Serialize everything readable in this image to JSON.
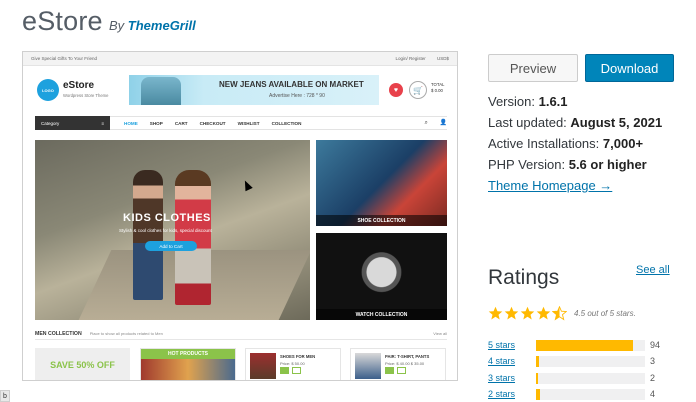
{
  "header": {
    "title": "eStore",
    "by_prefix": "By",
    "author": "ThemeGrill"
  },
  "screenshot": {
    "topbar_left": "Give Special Gifts To Your Friend",
    "topbar_links": [
      "Login/ Register",
      "USD$"
    ],
    "logo_text": "LOGO",
    "brand_name": "eStore",
    "brand_tagline": "Wordpress Store Theme",
    "ad_headline": "NEW JEANS AVAILABLE ON MARKET",
    "ad_sub": "Advertise Here : 728 * 90",
    "heart_icon": "♥",
    "cart_icon": "🛒",
    "total_label": "TOTAL",
    "total_value": "$ 0.00",
    "category_label": "Category",
    "category_icon": "≡",
    "nav": [
      "HOME",
      "SHOP",
      "CART",
      "CHECKOUT",
      "WISHLIST",
      "COLLECTION"
    ],
    "nav_icons": [
      "⌕",
      "👤"
    ],
    "hero_title": "KIDS CLOTHES",
    "hero_sub": "Stylish & cool clothes for kids, special discount",
    "hero_button": "Add to Cart",
    "shoe_caption": "SHOE COLLECTION",
    "watch_caption": "WATCH COLLECTION",
    "men_title": "MEN COLLECTION",
    "men_sub": "Place to show all products related to Men",
    "view_all": "View all",
    "save_text": "SAVE 50% OFF",
    "hot_products": "HOT PRODUCTS",
    "products": [
      {
        "name": "SHOES FOR MEN",
        "price": "Price: $ 50.00"
      },
      {
        "name": "PAIR: T-SHIRT, PANTS",
        "price": "Price: $ 40.00  $ 35.00"
      }
    ]
  },
  "actions": {
    "preview": "Preview",
    "download": "Download"
  },
  "meta": [
    {
      "label": "Version:",
      "value": "1.6.1"
    },
    {
      "label": "Last updated:",
      "value": "August 5, 2021"
    },
    {
      "label": "Active Installations:",
      "value": "7,000+"
    },
    {
      "label": "PHP Version:",
      "value": "5.6 or higher"
    }
  ],
  "theme_homepage": "Theme Homepage →",
  "ratings": {
    "title": "Ratings",
    "see_all": "See all",
    "summary": "4.5 out of 5 stars.",
    "star_color": "#ffb900",
    "average": 4.5,
    "bars": [
      {
        "label": "5 stars",
        "count": "94",
        "fraction": 0.89
      },
      {
        "label": "4 stars",
        "count": "3",
        "fraction": 0.03
      },
      {
        "label": "3 stars",
        "count": "2",
        "fraction": 0.02
      },
      {
        "label": "2 stars",
        "count": "4",
        "fraction": 0.04
      }
    ]
  },
  "corner_text": "b"
}
